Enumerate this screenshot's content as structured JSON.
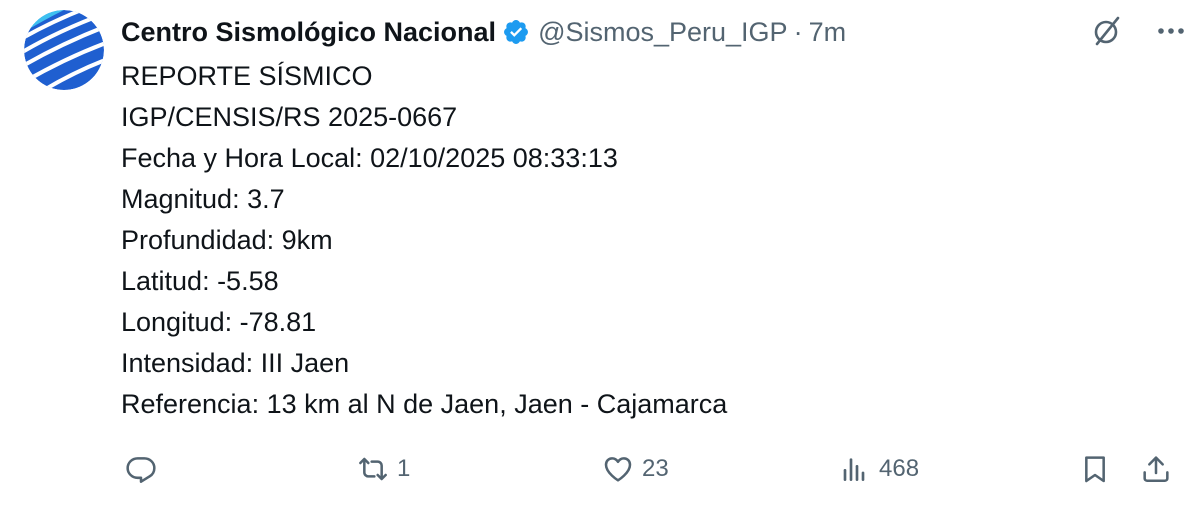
{
  "tweet": {
    "author_name": "Centro Sismológico Nacional",
    "handle": "@Sismos_Peru_IGP",
    "separator": "·",
    "time": "7m",
    "lines": [
      "REPORTE SÍSMICO",
      "IGP/CENSIS/RS 2025-0667",
      "Fecha y Hora Local: 02/10/2025 08:33:13",
      "Magnitud: 3.7",
      "Profundidad: 9km",
      "Latitud: -5.58",
      "Longitud: -78.81",
      "Intensidad: III Jaen",
      "Referencia: 13 km al N de Jaen, Jaen - Cajamarca"
    ]
  },
  "actions": {
    "replies": "",
    "reposts": "1",
    "likes": "23",
    "views": "468"
  },
  "icons": {
    "verified": "verified-badge-icon",
    "grok": "grok-icon",
    "more": "more-icon",
    "reply": "reply-icon",
    "repost": "repost-icon",
    "like": "heart-icon",
    "views": "analytics-icon",
    "bookmark": "bookmark-icon",
    "share": "share-icon"
  },
  "colors": {
    "text": "#0f1419",
    "secondary": "#536471",
    "verified": "#1d9bf0",
    "avatar_blue": "#1e63d6"
  }
}
